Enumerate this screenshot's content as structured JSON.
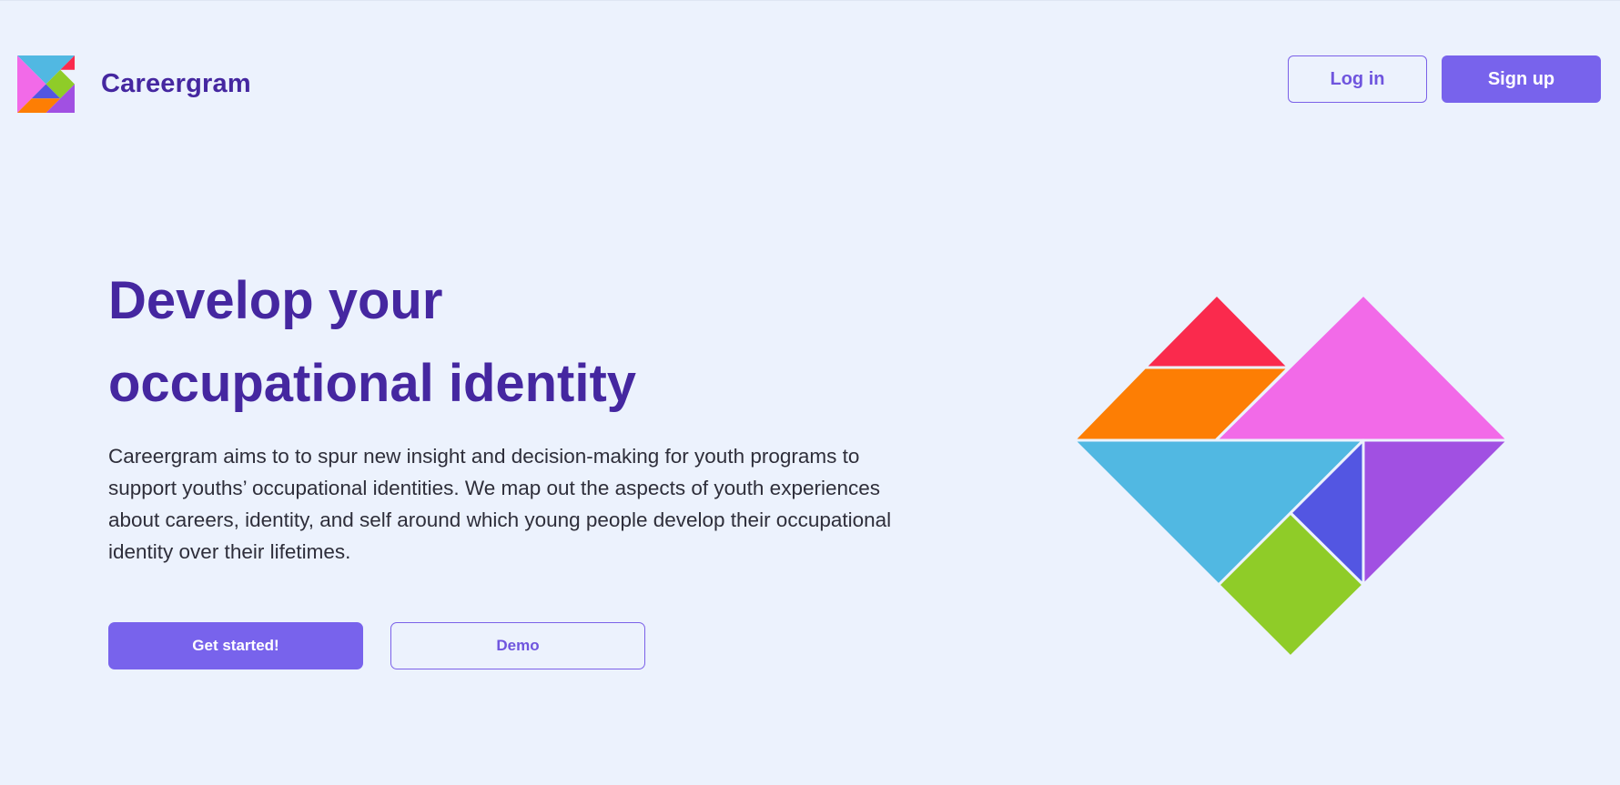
{
  "header": {
    "brand": "Careergram",
    "login_label": "Log in",
    "signup_label": "Sign up"
  },
  "hero": {
    "title_line1": "Develop your",
    "title_line2": "occupational identity",
    "description": "Careergram aims to to spur new insight and decision-making for youth programs to support youths’ occupational identities. We map out the aspects of youth experiences about careers, identity, and self around which young people develop their occupational identity over their lifetimes.",
    "primary_cta": "Get started!",
    "secondary_cta": "Demo"
  },
  "colors": {
    "background": "#ecf2fd",
    "brand_text": "#4527a0",
    "accent": "#7863ec",
    "tangram_red": "#fa2a4d",
    "tangram_orange": "#fd7e04",
    "tangram_pink": "#f26ae8",
    "tangram_cyan": "#51b8e2",
    "tangram_blue": "#5356e2",
    "tangram_purple": "#a150e2",
    "tangram_green": "#8fcc28"
  },
  "icons": {
    "logo": "tangram-logo-icon",
    "illustration": "tangram-heart-illustration"
  }
}
